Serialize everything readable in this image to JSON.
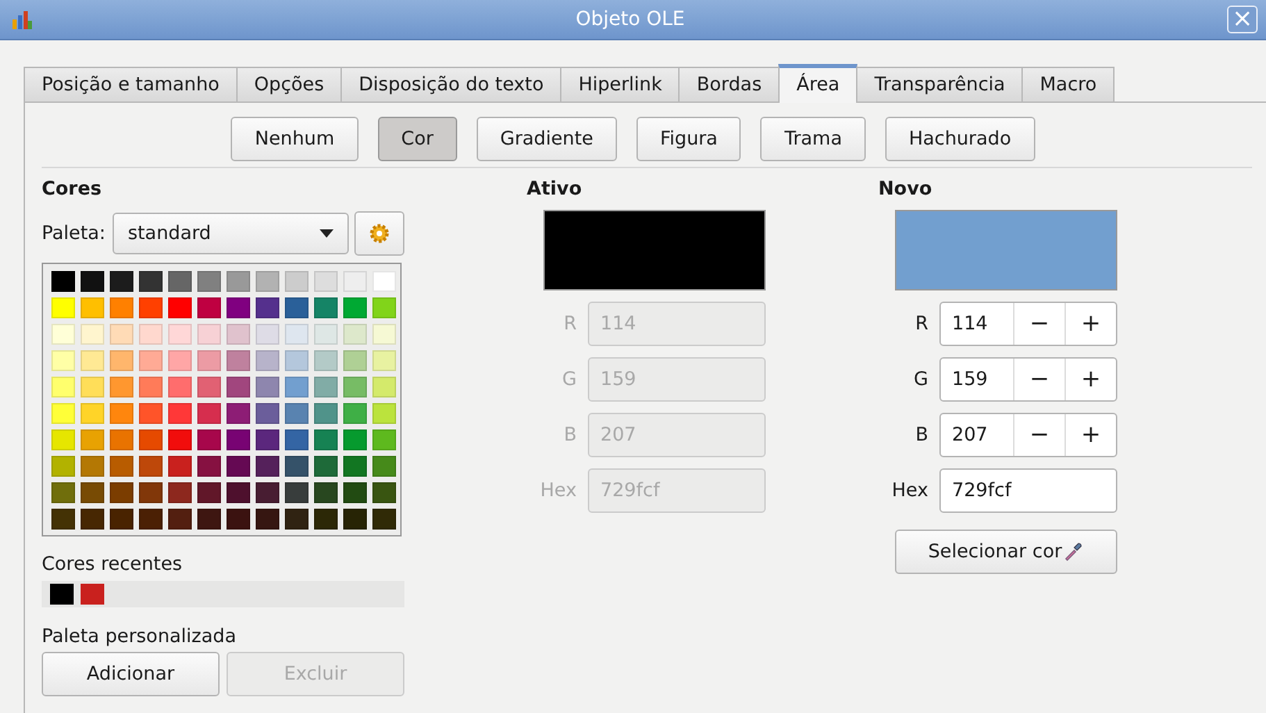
{
  "window": {
    "title": "Objeto OLE",
    "close": "×"
  },
  "tabs": [
    {
      "label": "Posição e tamanho",
      "selected": false
    },
    {
      "label": "Opções",
      "selected": false
    },
    {
      "label": "Disposição do texto",
      "selected": false
    },
    {
      "label": "Hiperlink",
      "selected": false
    },
    {
      "label": "Bordas",
      "selected": false
    },
    {
      "label": "Área",
      "selected": true
    },
    {
      "label": "Transparência",
      "selected": false
    },
    {
      "label": "Macro",
      "selected": false
    }
  ],
  "fill_types": [
    {
      "label": "Nenhum",
      "selected": false
    },
    {
      "label": "Cor",
      "selected": true
    },
    {
      "label": "Gradiente",
      "selected": false
    },
    {
      "label": "Figura",
      "selected": false
    },
    {
      "label": "Trama",
      "selected": false
    },
    {
      "label": "Hachurado",
      "selected": false
    }
  ],
  "colors": {
    "title": "Cores",
    "palette_label": "Paleta:",
    "palette_value": "standard",
    "swatch_rows": [
      [
        {
          "color": "#000000"
        },
        {
          "color": "#111111"
        },
        {
          "color": "#1c1c1c"
        },
        {
          "color": "#333333"
        },
        {
          "color": "#666666"
        },
        {
          "color": "#808080"
        },
        {
          "color": "#999999"
        },
        {
          "color": "#b2b2b2"
        },
        {
          "color": "#cccccc"
        },
        {
          "color": "#dddddd"
        },
        {
          "color": "#eeeeee"
        },
        {
          "color": "#ffffff"
        }
      ],
      [
        {
          "color": "#ffff00"
        },
        {
          "color": "#ffbf00"
        },
        {
          "color": "#ff8000"
        },
        {
          "color": "#ff4000"
        },
        {
          "color": "#ff0000"
        },
        {
          "color": "#bf0041"
        },
        {
          "color": "#800080"
        },
        {
          "color": "#55308d"
        },
        {
          "color": "#2a6099"
        },
        {
          "color": "#158466"
        },
        {
          "color": "#00a933"
        },
        {
          "color": "#81d41a"
        }
      ],
      [
        {
          "color": "#ffffd7"
        },
        {
          "color": "#fff5ce"
        },
        {
          "color": "#ffdbb6"
        },
        {
          "color": "#ffd8ce"
        },
        {
          "color": "#ffd7d7"
        },
        {
          "color": "#f7d1d5"
        },
        {
          "color": "#e0c2cd"
        },
        {
          "color": "#dedce6"
        },
        {
          "color": "#dee6ef"
        },
        {
          "color": "#dee7e5"
        },
        {
          "color": "#dde8cb"
        },
        {
          "color": "#f6f9d4"
        }
      ],
      [
        {
          "color": "#ffffa6"
        },
        {
          "color": "#ffe994"
        },
        {
          "color": "#ffb66c"
        },
        {
          "color": "#ffaa95"
        },
        {
          "color": "#ffa6a6"
        },
        {
          "color": "#ec9ba4"
        },
        {
          "color": "#bf819e"
        },
        {
          "color": "#b7b3ca"
        },
        {
          "color": "#b4c7dc"
        },
        {
          "color": "#b3cac7"
        },
        {
          "color": "#afd095"
        },
        {
          "color": "#e8f2a1"
        }
      ],
      [
        {
          "color": "#ffff6d"
        },
        {
          "color": "#ffde59"
        },
        {
          "color": "#ff972f"
        },
        {
          "color": "#ff7b59"
        },
        {
          "color": "#ff6d6d"
        },
        {
          "color": "#e16173"
        },
        {
          "color": "#a1467e"
        },
        {
          "color": "#8e86ae"
        },
        {
          "color": "#729fcf"
        },
        {
          "color": "#81aca6"
        },
        {
          "color": "#77bc65"
        },
        {
          "color": "#d4ea6b"
        }
      ],
      [
        {
          "color": "#ffff38"
        },
        {
          "color": "#ffd428"
        },
        {
          "color": "#ff860d"
        },
        {
          "color": "#ff5429"
        },
        {
          "color": "#ff3838"
        },
        {
          "color": "#d62e4e"
        },
        {
          "color": "#8d1d75"
        },
        {
          "color": "#6b5e9b"
        },
        {
          "color": "#5983b0"
        },
        {
          "color": "#50938a"
        },
        {
          "color": "#3faf46"
        },
        {
          "color": "#bbe33d"
        }
      ],
      [
        {
          "color": "#e6e600"
        },
        {
          "color": "#e8a202"
        },
        {
          "color": "#e97300"
        },
        {
          "color": "#e64a00"
        },
        {
          "color": "#f10d0c"
        },
        {
          "color": "#a7074b"
        },
        {
          "color": "#780373"
        },
        {
          "color": "#5b277d"
        },
        {
          "color": "#3465a4"
        },
        {
          "color": "#168253"
        },
        {
          "color": "#069a2e"
        },
        {
          "color": "#5eb91e"
        }
      ],
      [
        {
          "color": "#b2b200"
        },
        {
          "color": "#b47804"
        },
        {
          "color": "#b85c00"
        },
        {
          "color": "#be480a"
        },
        {
          "color": "#c9211e"
        },
        {
          "color": "#861141"
        },
        {
          "color": "#650953"
        },
        {
          "color": "#55215b"
        },
        {
          "color": "#355269"
        },
        {
          "color": "#1e6a39"
        },
        {
          "color": "#127622"
        },
        {
          "color": "#468a1a"
        }
      ],
      [
        {
          "color": "#706e0c"
        },
        {
          "color": "#784b04"
        },
        {
          "color": "#7b3d00"
        },
        {
          "color": "#813709"
        },
        {
          "color": "#8d281e"
        },
        {
          "color": "#611729"
        },
        {
          "color": "#4e102d"
        },
        {
          "color": "#481d32"
        },
        {
          "color": "#383d3c"
        },
        {
          "color": "#28471f"
        },
        {
          "color": "#224b12"
        },
        {
          "color": "#395511"
        }
      ],
      [
        {
          "color": "#443205"
        },
        {
          "color": "#472702"
        },
        {
          "color": "#492300"
        },
        {
          "color": "#4b2004"
        },
        {
          "color": "#531f10"
        },
        {
          "color": "#3e1611"
        },
        {
          "color": "#3b1210"
        },
        {
          "color": "#361611"
        },
        {
          "color": "#302312"
        },
        {
          "color": "#2c2806"
        },
        {
          "color": "#272405"
        },
        {
          "color": "#302a06"
        }
      ]
    ],
    "recent_label": "Cores recentes",
    "recent": [
      {
        "color": "#000000"
      },
      {
        "color": "#c9211e"
      }
    ],
    "custom_label": "Paleta personalizada",
    "buttons": [
      {
        "label": "Adicionar",
        "disabled": false
      },
      {
        "label": "Excluir",
        "disabled": true
      }
    ]
  },
  "active": {
    "title": "Ativo",
    "color": "#000000",
    "fields": [
      {
        "label": "R",
        "value": "114",
        "disabled": true
      },
      {
        "label": "G",
        "value": "159",
        "disabled": true
      },
      {
        "label": "B",
        "value": "207",
        "disabled": true
      },
      {
        "label": "Hex",
        "value": "729fcf",
        "disabled": true
      }
    ]
  },
  "new": {
    "title": "Novo",
    "color": "#729fcf",
    "fields": [
      {
        "label": "R",
        "value": "114",
        "disabled": false,
        "spin": [
          "−",
          "+"
        ]
      },
      {
        "label": "G",
        "value": "159",
        "disabled": false,
        "spin": [
          "−",
          "+"
        ]
      },
      {
        "label": "B",
        "value": "207",
        "disabled": false,
        "spin": [
          "−",
          "+"
        ]
      },
      {
        "label": "Hex",
        "value": "729fcf",
        "disabled": false
      }
    ],
    "pick_button": "Selecionar cor"
  }
}
